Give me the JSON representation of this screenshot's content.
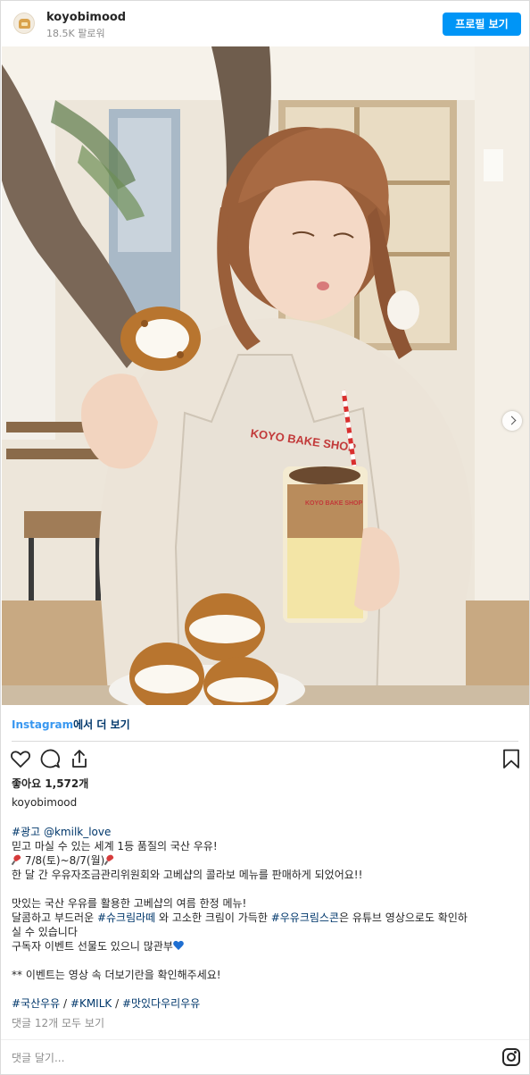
{
  "header": {
    "username": "koyobimood",
    "followers": "18.5K 팔로워",
    "profile_button": "프로필 보기",
    "avatar_icon": "bread-avatar-icon"
  },
  "photo": {
    "apron_text": "KOYO BAKE SHOP",
    "cup_text": "KOYO BAKE SHOP",
    "next_icon": "chevron-right-icon"
  },
  "more": {
    "brand": "Instagram",
    "label": "에서 더 보기"
  },
  "actions": {
    "like_icon": "heart-icon",
    "comment_icon": "comment-icon",
    "share_icon": "share-icon",
    "save_icon": "bookmark-icon"
  },
  "likes": "좋아요 1,572개",
  "caption": {
    "username": "koyobimood",
    "ad_tag": "#광고",
    "mention": "@kmilk_love",
    "line2": "믿고 마실 수 있는 세계 1등 품질의 국산 우유!",
    "line3": "7/8(토)~8/7(월)",
    "line4": "한 달 간 우유자조금관리위원회와 고베샵의 콜라보 메뉴를 판매하게 되었어요!!",
    "line6": "맛있는 국산 우유를 활용한 고베샵의 여름 한정 메뉴!",
    "line7a": "달콤하고 부드러운 ",
    "line7_tag1": "#슈크림라떼",
    "line7b": " 와 고소한 크림이 가득한 ",
    "line7_tag2": "#우유크림스콘",
    "line7c": "은 유튜브 영상으로도 확인하",
    "line8": "실 수 있습니다",
    "line9": "구독자 이벤트 선물도 있으니 많관부",
    "line11": "** 이벤트는 영상 속 더보기란을 확인해주세요!",
    "tag_a": "#국산우유",
    "sep1": " / ",
    "tag_b": "#KMILK",
    "sep2": " / ",
    "tag_c": "#맛있다우리우유"
  },
  "comments_link": "댓글 12개 모두 보기",
  "comment_placeholder": "댓글 달기...",
  "instagram_icon": "instagram-logo-icon",
  "colors": {
    "primary_button": "#0095f6",
    "link": "#00376b",
    "muted": "#8e8e8e"
  }
}
